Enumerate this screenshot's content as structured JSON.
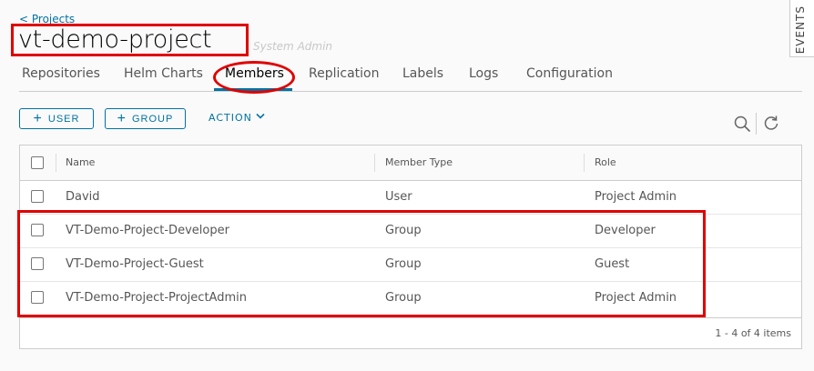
{
  "header": {
    "back_link": "< Projects",
    "project_title": "vt-demo-project",
    "user_role": "System Admin",
    "events_tab": "EVENTS"
  },
  "tabs": [
    {
      "label": "Repositories"
    },
    {
      "label": "Helm Charts"
    },
    {
      "label": "Members",
      "active": true
    },
    {
      "label": "Replication"
    },
    {
      "label": "Labels"
    },
    {
      "label": "Logs"
    },
    {
      "label": "Configuration"
    }
  ],
  "toolbar": {
    "add_user": "USER",
    "add_group": "GROUP",
    "action": "ACTION"
  },
  "table": {
    "columns": [
      "Name",
      "Member Type",
      "Role"
    ],
    "rows": [
      {
        "name": "David",
        "type": "User",
        "role": "Project Admin"
      },
      {
        "name": "VT-Demo-Project-Developer",
        "type": "Group",
        "role": "Developer"
      },
      {
        "name": "VT-Demo-Project-Guest",
        "type": "Group",
        "role": "Guest"
      },
      {
        "name": "VT-Demo-Project-ProjectAdmin",
        "type": "Group",
        "role": "Project Admin"
      }
    ],
    "pagination": "1 - 4 of 4 items"
  },
  "colors": {
    "accent": "#0072a3",
    "highlight": "#e00000"
  }
}
